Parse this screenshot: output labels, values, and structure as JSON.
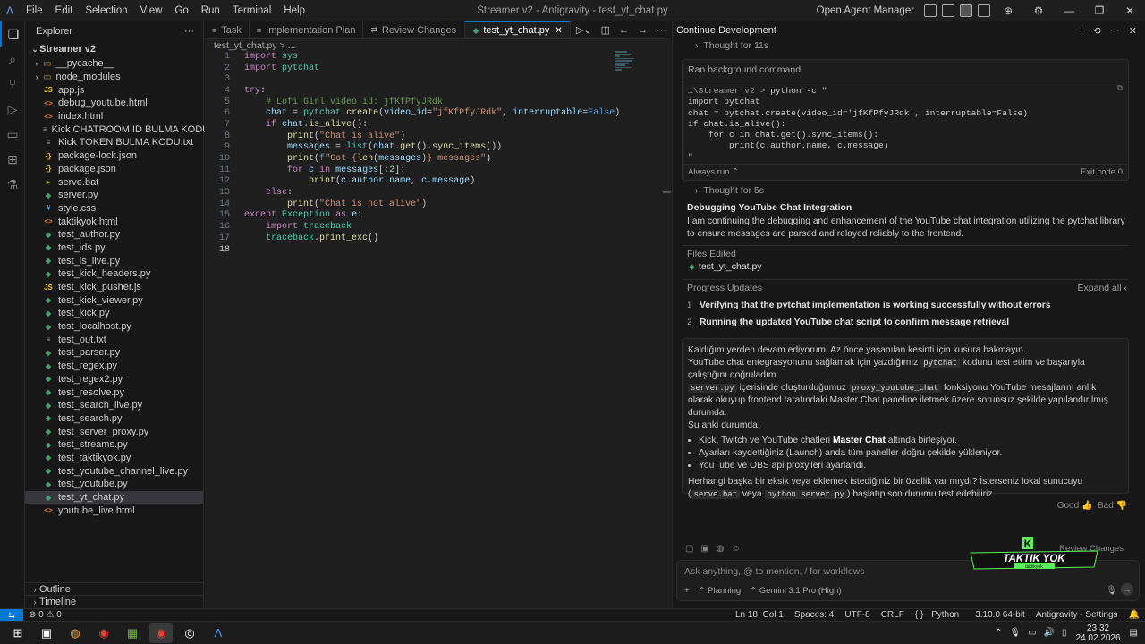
{
  "titlebar": {
    "menu": [
      "File",
      "Edit",
      "Selection",
      "View",
      "Go",
      "Run",
      "Terminal",
      "Help"
    ],
    "window_title": "Streamer v2 - Antigravity - test_yt_chat.py",
    "open_agent_manager": "Open Agent Manager"
  },
  "explorer": {
    "title": "Explorer",
    "project": "Streamer v2",
    "folders": [
      "__pycache__",
      "node_modules"
    ],
    "files": [
      {
        "name": "app.js",
        "icon": "JS",
        "color": "#e8c33b"
      },
      {
        "name": "debug_youtube.html",
        "icon": "<>",
        "color": "#e37933"
      },
      {
        "name": "index.html",
        "icon": "<>",
        "color": "#e37933"
      },
      {
        "name": "Kick CHATROOM ID BULMA KODU.txt",
        "icon": "≡",
        "color": "#a0a0a0"
      },
      {
        "name": "Kick TOKEN BULMA KODU.txt",
        "icon": "≡",
        "color": "#a0a0a0"
      },
      {
        "name": "package-lock.json",
        "icon": "{}",
        "color": "#e8c33b"
      },
      {
        "name": "package.json",
        "icon": "{}",
        "color": "#e8c33b"
      },
      {
        "name": "serve.bat",
        "icon": "▸",
        "color": "#c1d63a"
      },
      {
        "name": "server.py",
        "icon": "◆",
        "color": "#4b9e6f"
      },
      {
        "name": "style.css",
        "icon": "#",
        "color": "#42a5f5"
      },
      {
        "name": "taktikyok.html",
        "icon": "<>",
        "color": "#e37933"
      },
      {
        "name": "test_author.py",
        "icon": "◆",
        "color": "#4b9e6f"
      },
      {
        "name": "test_ids.py",
        "icon": "◆",
        "color": "#4b9e6f"
      },
      {
        "name": "test_is_live.py",
        "icon": "◆",
        "color": "#4b9e6f"
      },
      {
        "name": "test_kick_headers.py",
        "icon": "◆",
        "color": "#4b9e6f"
      },
      {
        "name": "test_kick_pusher.js",
        "icon": "JS",
        "color": "#e8c33b"
      },
      {
        "name": "test_kick_viewer.py",
        "icon": "◆",
        "color": "#4b9e6f"
      },
      {
        "name": "test_kick.py",
        "icon": "◆",
        "color": "#4b9e6f"
      },
      {
        "name": "test_localhost.py",
        "icon": "◆",
        "color": "#4b9e6f"
      },
      {
        "name": "test_out.txt",
        "icon": "≡",
        "color": "#a0a0a0"
      },
      {
        "name": "test_parser.py",
        "icon": "◆",
        "color": "#4b9e6f"
      },
      {
        "name": "test_regex.py",
        "icon": "◆",
        "color": "#4b9e6f"
      },
      {
        "name": "test_regex2.py",
        "icon": "◆",
        "color": "#4b9e6f"
      },
      {
        "name": "test_resolve.py",
        "icon": "◆",
        "color": "#4b9e6f"
      },
      {
        "name": "test_search_live.py",
        "icon": "◆",
        "color": "#4b9e6f"
      },
      {
        "name": "test_search.py",
        "icon": "◆",
        "color": "#4b9e6f"
      },
      {
        "name": "test_server_proxy.py",
        "icon": "◆",
        "color": "#4b9e6f"
      },
      {
        "name": "test_streams.py",
        "icon": "◆",
        "color": "#4b9e6f"
      },
      {
        "name": "test_taktikyok.py",
        "icon": "◆",
        "color": "#4b9e6f"
      },
      {
        "name": "test_youtube_channel_live.py",
        "icon": "◆",
        "color": "#4b9e6f"
      },
      {
        "name": "test_youtube.py",
        "icon": "◆",
        "color": "#4b9e6f"
      },
      {
        "name": "test_yt_chat.py",
        "icon": "◆",
        "color": "#4b9e6f",
        "selected": true
      },
      {
        "name": "youtube_live.html",
        "icon": "<>",
        "color": "#e37933"
      }
    ],
    "outline": "Outline",
    "timeline": "Timeline"
  },
  "editor": {
    "tabs": [
      {
        "label": "Task",
        "icon": "≡"
      },
      {
        "label": "Implementation Plan",
        "icon": "≡"
      },
      {
        "label": "Review Changes",
        "icon": "⇄"
      },
      {
        "label": "test_yt_chat.py",
        "icon": "◆",
        "active": true
      }
    ],
    "breadcrumb": "test_yt_chat.py > ...",
    "lines": [
      "<span class='kw'>import</span> <span class='md'>sys</span>",
      "<span class='kw'>import</span> <span class='md'>pytchat</span>",
      "",
      "<span class='kw'>try</span>:",
      "    <span class='cm'># Lofi Girl video id: jfKfPfyJRdk</span>",
      "    <span class='va'>chat</span> = <span class='md'>pytchat</span>.<span class='fn'>create</span>(<span class='va'>video_id</span>=<span class='st'>\"jfKfPfyJRdk\"</span>, <span class='va'>interruptable</span>=<span class='bl'>False</span>)",
      "    <span class='kw'>if</span> <span class='va'>chat</span>.<span class='fn'>is_alive</span>():",
      "        <span class='fn'>print</span>(<span class='st'>\"Chat is alive\"</span>)",
      "        <span class='va'>messages</span> = <span class='md'>list</span>(<span class='va'>chat</span>.<span class='fn'>get</span>().<span class='fn'>sync_items</span>())",
      "        <span class='fn'>print</span>(<span class='bl'>f</span><span class='st'>\"Got {</span><span class='fn'>len</span>(<span class='va'>messages</span>)<span class='st'>} messages\"</span>)",
      "        <span class='kw'>for</span> <span class='va'>c</span> <span class='kw'>in</span> <span class='va'>messages</span>[:<span class='nu'>2</span>]:",
      "            <span class='fn'>print</span>(<span class='va'>c</span>.<span class='va'>author</span>.<span class='va'>name</span>, <span class='va'>c</span>.<span class='va'>message</span>)",
      "    <span class='kw'>else</span>:",
      "        <span class='fn'>print</span>(<span class='st'>\"Chat is not alive\"</span>)",
      "<span class='kw'>except</span> <span class='md'>Exception</span> <span class='kw'>as</span> <span class='va'>e</span>:",
      "    <span class='kw'>import</span> <span class='md'>traceback</span>",
      "    <span class='md'>traceback</span>.<span class='fn'>print_exc</span>()",
      ""
    ]
  },
  "agent": {
    "title": "Continue Development",
    "thought1": "Thought for 11s",
    "cmd_header": "Ran background command",
    "cmd_prompt": "…\\Streamer v2 > ",
    "cmd_lines": [
      "python -c \"",
      "import pytchat",
      "chat = pytchat.create(video_id='jfKfPfyJRdk', interruptable=False)",
      "if chat.is_alive():",
      "    for c in chat.get().sync_items():",
      "        print(c.author.name, c.message)",
      "\""
    ],
    "always_run": "Always run",
    "exit_code": "Exit code 0",
    "thought2": "Thought for 5s",
    "section_title": "Debugging YouTube Chat Integration",
    "section_body": "I am continuing the debugging and enhancement of the YouTube chat integration utilizing the pytchat library to ensure messages are parsed and relayed reliably to the frontend.",
    "files_edited_label": "Files Edited",
    "files_edited": "test_yt_chat.py",
    "progress_label": "Progress Updates",
    "expand_all": "Expand all",
    "progress": [
      {
        "n": "1",
        "text": "Verifying that the pytchat implementation is working successfully without errors"
      },
      {
        "n": "2",
        "text": "Running the updated YouTube chat script to confirm message retrieval"
      }
    ],
    "msg_p1": "Kaldığım yerden devam ediyorum. Az önce yaşanılan kesinti için kusura bakmayın.",
    "msg_p2a": "YouTube chat entegrasyonunu sağlamak için yazdığımız ",
    "msg_chip1": "pytchat",
    "msg_p2b": " kodunu test ettim ve başarıyla çalıştığını doğruladım.",
    "msg_chip2": "server.py",
    "msg_p3a": " içerisinde oluşturduğumuz ",
    "msg_chip3": "proxy_youtube_chat",
    "msg_p3b": " fonksiyonu YouTube mesajlarını anlık olarak okuyup frontend tarafındaki Master Chat paneline iletmek üzere sorunsuz şekilde yapılandırılmış durumda.",
    "msg_p4": "Şu anki durumda:",
    "bullets": [
      {
        "pre": "Kick, Twitch ve YouTube chatleri ",
        "bold": "Master Chat",
        "post": " altında birleşiyor."
      },
      {
        "pre": "Ayarları kaydettiğiniz (Launch) anda tüm paneller doğru şekilde yükleniyor.",
        "bold": "",
        "post": ""
      },
      {
        "pre": "YouTube ve OBS api proxy'leri ayarlandı.",
        "bold": "",
        "post": ""
      }
    ],
    "msg_p5a": "Herhangi başka bir eksik veya eklemek istediğiniz bir özellik var mıydı? İsterseniz lokal sunucuyu (",
    "msg_chip4": "serve.bat",
    "msg_p5b": " veya ",
    "msg_chip5": "python server.py",
    "msg_p5c": ") başlatıp son durumu test edebiliriz.",
    "good": "Good",
    "bad": "Bad",
    "review_changes": "Review Changes",
    "input_placeholder": "Ask anything, @ to mention, / for workflows",
    "mode": "Planning",
    "model": "Gemini 3.1 Pro (High)"
  },
  "overlay": {
    "line1": "TAKTIK YOK",
    "line2": "taktikyok",
    "letter": "K"
  },
  "status": {
    "errors": "0",
    "warnings": "0",
    "ln_col": "Ln 18, Col 1",
    "spaces": "Spaces: 4",
    "encoding": "UTF-8",
    "eol": "CRLF",
    "language": "Python",
    "interpreter": "3.10.0 64-bit",
    "settings": "Antigravity - Settings"
  },
  "taskbar": {
    "time": "23:32",
    "date": "24.02.2026",
    "icons": [
      {
        "name": "start-icon",
        "glyph": "⊞",
        "color": "#ffffff"
      },
      {
        "name": "taskview-icon",
        "glyph": "▣",
        "color": "#ffffff"
      },
      {
        "name": "copilot-icon",
        "glyph": "◍",
        "color": "#f2a23c"
      },
      {
        "name": "chrome-icon",
        "glyph": "◉",
        "color": "#e94235"
      },
      {
        "name": "minecraft-icon",
        "glyph": "▦",
        "color": "#7ab648"
      },
      {
        "name": "chrome2-icon",
        "glyph": "◉",
        "color": "#e94235"
      },
      {
        "name": "obs-icon",
        "glyph": "◎",
        "color": "#ffffff"
      },
      {
        "name": "antigravity-icon",
        "glyph": "Λ",
        "color": "#5aa0ff"
      }
    ]
  }
}
